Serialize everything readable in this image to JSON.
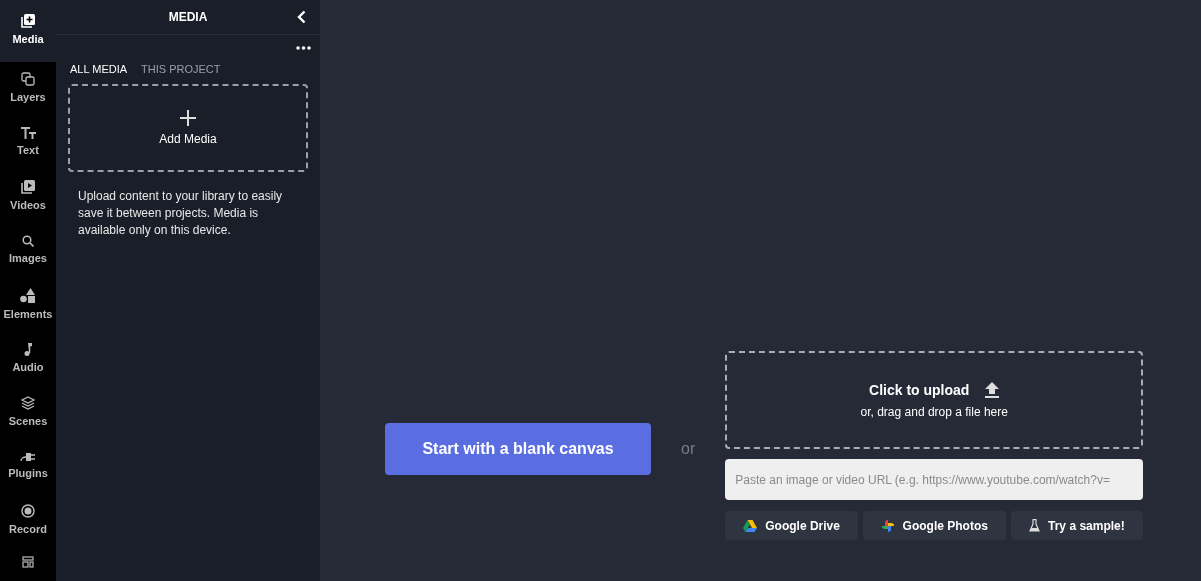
{
  "sidebar": {
    "items": [
      {
        "label": "Media",
        "selected": true
      },
      {
        "label": "Layers",
        "selected": false
      },
      {
        "label": "Text",
        "selected": false
      },
      {
        "label": "Videos",
        "selected": false
      },
      {
        "label": "Images",
        "selected": false
      },
      {
        "label": "Elements",
        "selected": false
      },
      {
        "label": "Audio",
        "selected": false
      },
      {
        "label": "Scenes",
        "selected": false
      },
      {
        "label": "Plugins",
        "selected": false
      },
      {
        "label": "Record",
        "selected": false
      }
    ]
  },
  "panel": {
    "title": "MEDIA",
    "tabs": [
      {
        "label": "ALL MEDIA",
        "selected": true
      },
      {
        "label": "THIS PROJECT",
        "selected": false
      }
    ],
    "add_label": "Add Media",
    "note": "Upload content to your library to easily save it between projects. Media is available only on this device."
  },
  "main": {
    "blank_button": "Start with a blank canvas",
    "or": "or",
    "upload_title": "Click to upload",
    "upload_sub": "or, drag and drop a file here",
    "url_placeholder": "Paste an image or video URL (e.g. https://www.youtube.com/watch?v=",
    "sources": [
      {
        "label": "Google Drive"
      },
      {
        "label": "Google Photos"
      },
      {
        "label": "Try a sample!"
      }
    ]
  }
}
